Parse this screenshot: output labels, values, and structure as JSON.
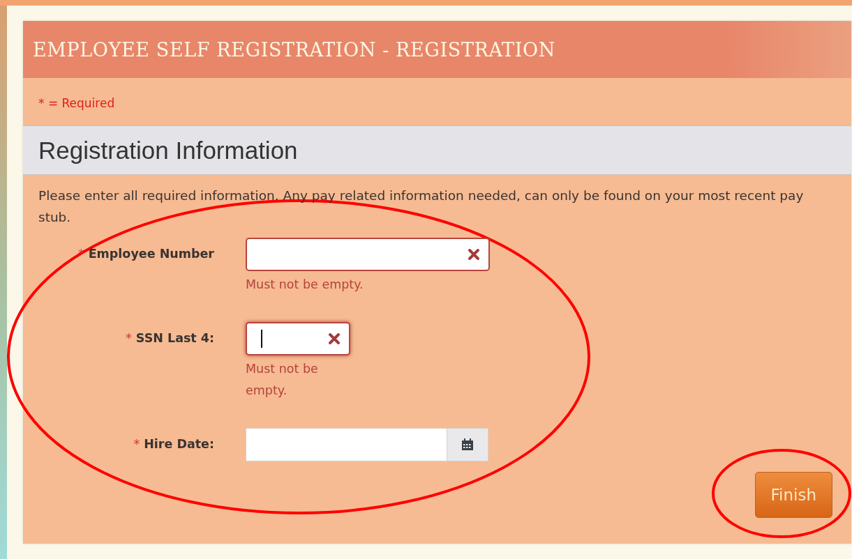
{
  "header": {
    "title": "EMPLOYEE SELF REGISTRATION - REGISTRATION"
  },
  "required_note": "* = Required",
  "section": {
    "title": "Registration Information",
    "description": "Please enter all required information. Any pay related information needed, can only be found on your most recent pay stub.",
    "fields": [
      {
        "kind": "text",
        "marker": "*",
        "label": "Employee Number",
        "invalid": true,
        "focused": false,
        "error": "Must not be empty."
      },
      {
        "kind": "short",
        "marker": "*",
        "label": "SSN Last 4:",
        "invalid": true,
        "focused": true,
        "error": "Must not be empty."
      },
      {
        "kind": "date",
        "marker": "*",
        "label": "Hire Date:",
        "invalid": false,
        "focused": false
      }
    ]
  },
  "buttons": [
    {
      "label": "Finish"
    }
  ]
}
